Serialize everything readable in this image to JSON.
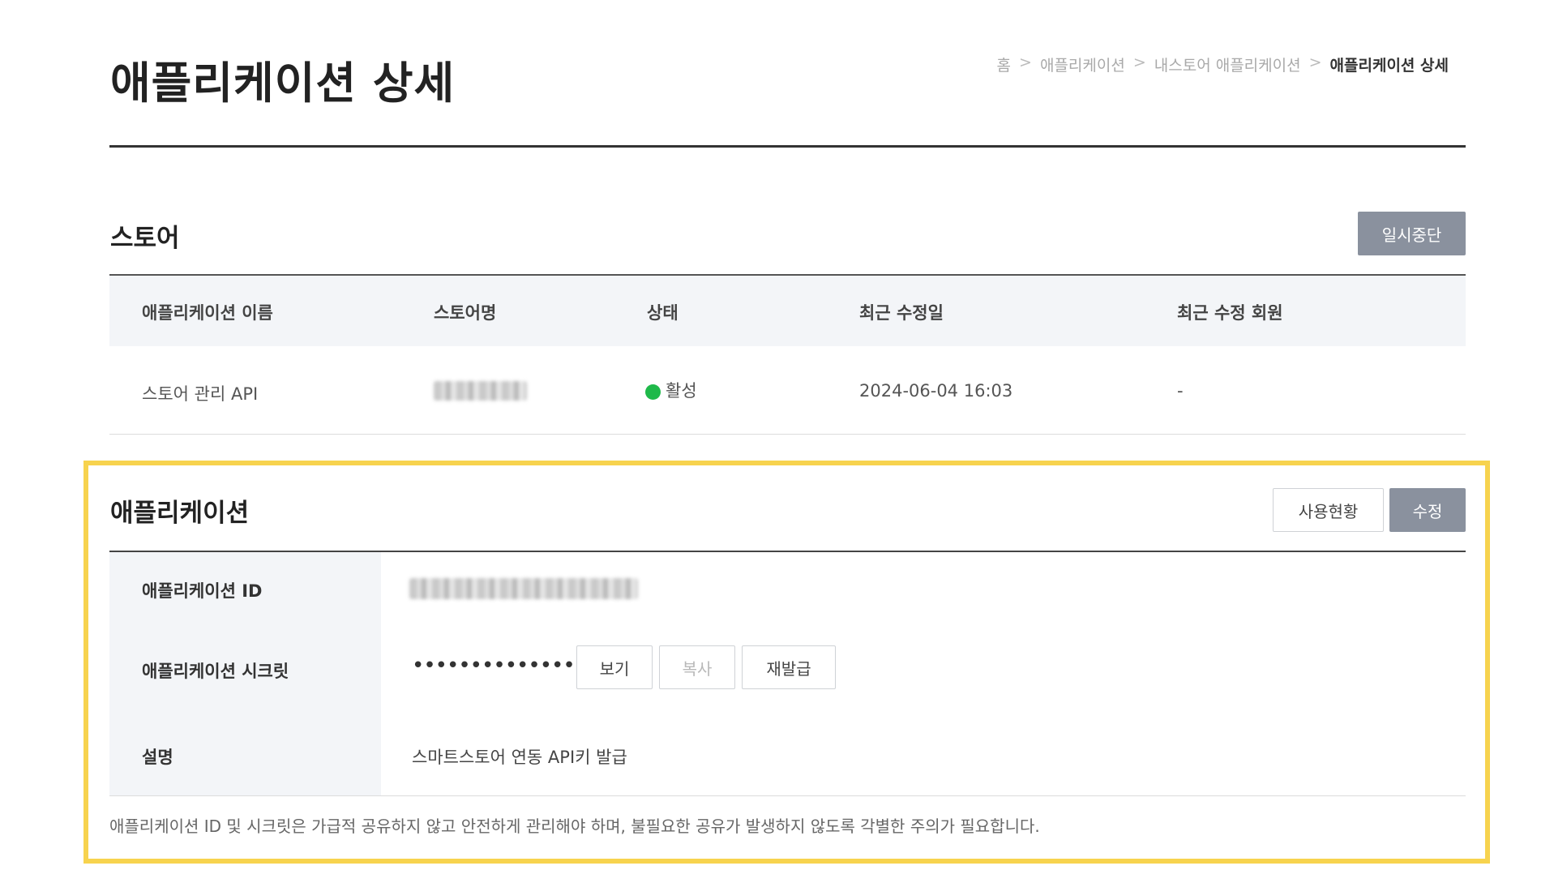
{
  "page": {
    "title": "애플리케이션 상세",
    "breadcrumb": [
      "홈",
      "애플리케이션",
      "내스토어 애플리케이션",
      "애플리케이션 상세"
    ],
    "breadcrumb_separator": ">"
  },
  "store_section": {
    "title": "스토어",
    "pause_button": "일시중단",
    "columns": [
      "애플리케이션 이름",
      "스토어명",
      "상태",
      "최근 수정일",
      "최근 수정 회원"
    ],
    "row": {
      "app_name": "스토어 관리 API",
      "store_name_redacted": true,
      "status": "활성",
      "status_color": "#1fb94a",
      "modified_at": "2024-06-04 16:03",
      "modified_by": "-"
    }
  },
  "app_section": {
    "title": "애플리케이션",
    "usage_button": "사용현황",
    "edit_button": "수정",
    "id_label": "애플리케이션 ID",
    "id_value_redacted": true,
    "secret_label": "애플리케이션 시크릿",
    "secret_mask": "••••••••••••••",
    "view_button": "보기",
    "copy_button": "복사",
    "reissue_button": "재발급",
    "description_label": "설명",
    "description_value": "스마트스토어 연동 API키 발급",
    "notice": "애플리케이션 ID 및 시크릿은 가급적 공유하지 않고 안전하게 관리해야 하며, 불필요한 공유가 발생하지 않도록 각별한 주의가 필요합니다."
  },
  "colors": {
    "highlight_border": "#f7d34e",
    "dark_button": "#8a919e",
    "header_bg": "#f3f5f8"
  }
}
